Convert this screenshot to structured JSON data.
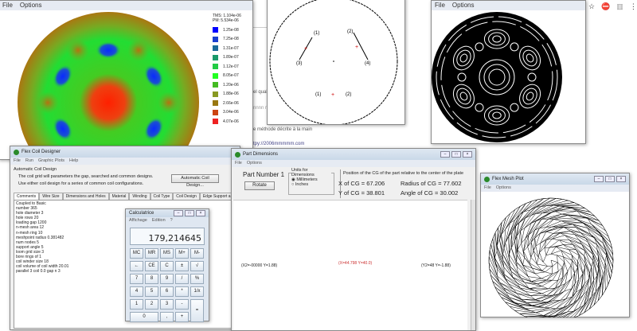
{
  "browser": {
    "icons": [
      "star-icon",
      "stop-icon",
      "extension-icon",
      "menu-icon"
    ],
    "text_lines": [
      "el qual",
      "nnnn n",
      "e méthode décrite à la main",
      "tpy://2006mmmmm.com"
    ]
  },
  "contour_window": {
    "menu": [
      "File",
      "Options"
    ],
    "legend": {
      "header": [
        "TMS: 1.104e-06",
        "PM: 5.534e-06"
      ],
      "items": [
        {
          "label": "1.25e-08",
          "color": "#0000ff"
        },
        {
          "label": "7.25e-08",
          "color": "#1a3fd0"
        },
        {
          "label": "1.31e-07",
          "color": "#1a6a9a"
        },
        {
          "label": "1.89e-07",
          "color": "#1a9a6a"
        },
        {
          "label": "1.12e-07",
          "color": "#22cc44"
        },
        {
          "label": "8.05e-07",
          "color": "#22ff22"
        },
        {
          "label": "1.20e-06",
          "color": "#44bb22"
        },
        {
          "label": "1.88e-06",
          "color": "#889922"
        },
        {
          "label": "2.66e-06",
          "color": "#997711"
        },
        {
          "label": "3.04e-06",
          "color": "#cc4411"
        },
        {
          "label": "4.07e-06",
          "color": "#ee2222"
        }
      ]
    }
  },
  "part_plot_window": {
    "labels": [
      "(1)",
      "(2)",
      "(3)",
      "(4)",
      "(1)",
      "(2)"
    ]
  },
  "field_lines_window": {
    "menu": [
      "File",
      "Options"
    ]
  },
  "coil_designer": {
    "title": "Flex Coil Designer",
    "menu": [
      "File",
      "Run",
      "Graphic Plots",
      "Help"
    ],
    "group_title": "Automatic Coil Design",
    "desc1": "The coil grid will parameters the gap, searched and common designs.",
    "desc2": "Use either coil design for a series of common coil configurations.",
    "auto_button": "Automatic Coil Design...",
    "tabs": [
      "Comments",
      "Wire Size",
      "Dimensions and Holes",
      "Material",
      "Winding",
      "Coil Type",
      "Coil Design",
      "Edge Support and Fill",
      "Coil Parts"
    ],
    "lines": [
      "Coupled to Basic",
      "number 365",
      "hole diameter 3",
      "hole rows 20",
      "loading gap 1200",
      "n-mesh area 12",
      "n-mesh ring 10",
      "meshpoint radius 0.381482",
      "num nodes 5",
      "support angle 5",
      "loom grid size 3",
      "bore rings of 1",
      "coil winder size 18",
      "coil volume of coil width 20.01",
      "parallel 3 coil 0.0 gap n 3"
    ]
  },
  "calculator": {
    "title": "Calculatrice",
    "menu": [
      "Affichage",
      "Edition",
      "?"
    ],
    "display": "179,214645",
    "rows": [
      [
        "MC",
        "MR",
        "MS",
        "M+",
        "M-"
      ],
      [
        "←",
        "CE",
        "C",
        "±",
        "√"
      ],
      [
        "7",
        "8",
        "9",
        "/",
        "%"
      ],
      [
        "4",
        "5",
        "6",
        "*",
        "1/x"
      ],
      [
        "1",
        "2",
        "3",
        "-",
        "="
      ],
      [
        "0",
        ",",
        "+"
      ]
    ]
  },
  "part_dimensions": {
    "title": "Part Dimensions",
    "menu": [
      "File",
      "Options"
    ],
    "part_number": "Part Number 1",
    "rotate_button": "Rotate",
    "units_title": "Units for Dimensions",
    "units": [
      "Millimeters",
      "Inches"
    ],
    "units_selected": 0,
    "cg_caption": "Position of the CG of the part relative to the center of the plate",
    "x_cg": "X of CG = 67.206",
    "y_cg": "Y of CG = 38.801",
    "radius_cg": "Radius of CG = 77.602",
    "angle_cg": "Angle of CG = 30.002",
    "left_label": "(X2=-00000 Y=1.88)",
    "center_label": "(X=44.798 Y=40.0)",
    "right_label": "(Y2=48 Y=-1.88)"
  },
  "mesh_plot": {
    "title": "Flex Mesh Plot",
    "menu": [
      "File",
      "Options"
    ]
  }
}
